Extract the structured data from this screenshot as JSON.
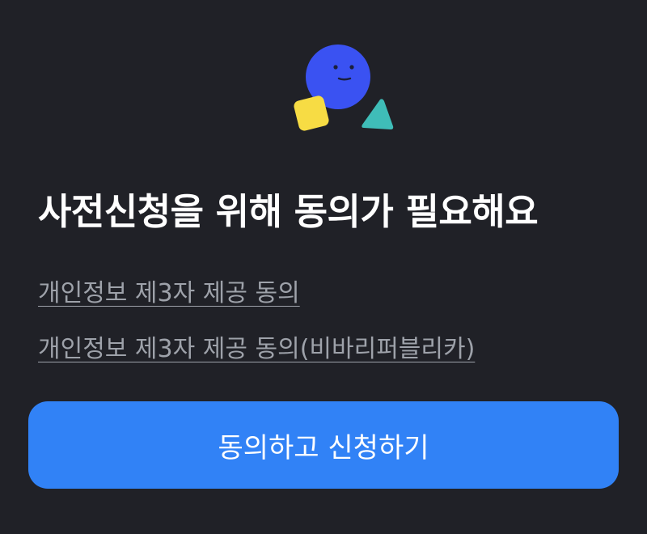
{
  "illustration": {
    "icon": "shapes-mascot-icon",
    "colors": {
      "circle": "#3a52f2",
      "square": "#f7dc44",
      "triangle": "#3fbdb8",
      "face": "#1a1f3b"
    }
  },
  "title": "사전신청을 위해 동의가 필요해요",
  "links": [
    {
      "label": "개인정보 제3자 제공 동의"
    },
    {
      "label": "개인정보 제3자 제공 동의(비바리퍼블리카)"
    }
  ],
  "cta": {
    "label": "동의하고 신청하기",
    "color": "#3182f6"
  },
  "theme": {
    "background": "#202127",
    "link_color": "#9ea2aa"
  }
}
